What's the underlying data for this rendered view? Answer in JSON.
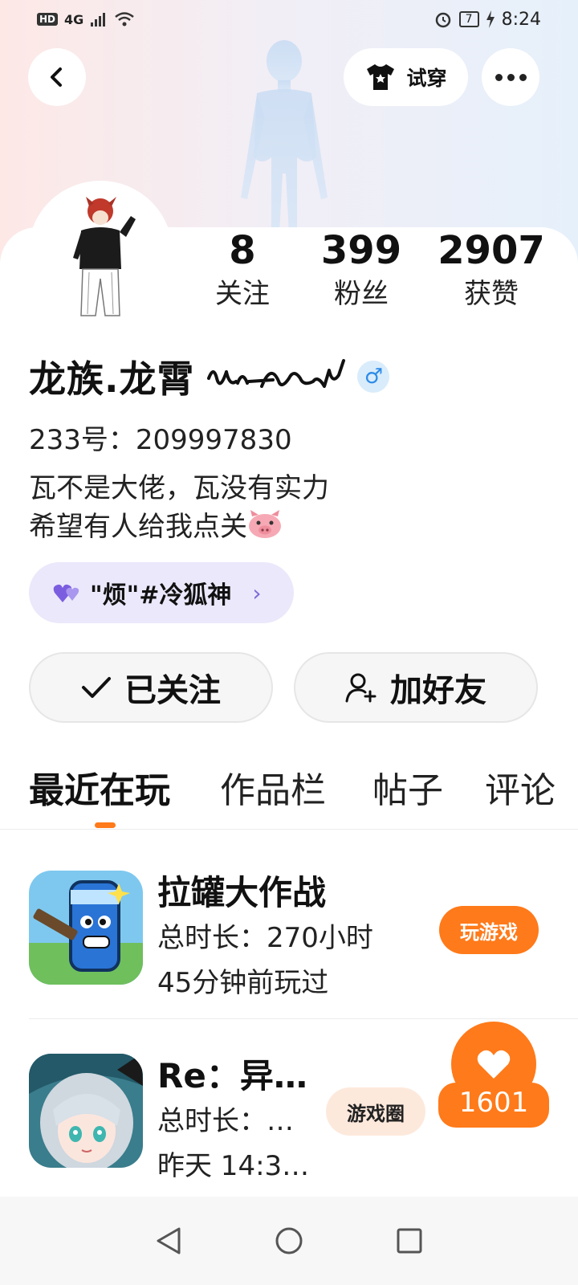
{
  "status_bar": {
    "network_badge": "HD",
    "signal": "4G",
    "battery": "7",
    "time": "8:24"
  },
  "header": {
    "tryon_label": "试穿"
  },
  "profile": {
    "name": "龙族.龙霄",
    "uid_label": "233号：209997830",
    "bio_lines": [
      "瓦不是大佬，瓦没有实力",
      "希望有人给我点关"
    ],
    "tag_label": "\"烦\"#冷狐神",
    "stats": [
      {
        "value": "8",
        "label": "关注"
      },
      {
        "value": "399",
        "label": "粉丝"
      },
      {
        "value": "2907",
        "label": "获赞"
      }
    ]
  },
  "actions": {
    "follow_label": "已关注",
    "add_friend_label": "加好友"
  },
  "tabs": [
    "最近在玩",
    "作品栏",
    "帖子",
    "评论"
  ],
  "games": [
    {
      "title": "拉罐大作战",
      "line1": "总时长：270小时",
      "line2": "45分钟前玩过",
      "button": "玩游戏"
    },
    {
      "title": "Re：异…",
      "line1": "总时长：…",
      "line2": "昨天 14:3…",
      "button": "游戏圈"
    }
  ],
  "like_float": {
    "count": "1601"
  },
  "colors": {
    "accent": "#ff7a1a",
    "tag_bg": "#ebe8fb",
    "gender": "#2d8be8"
  }
}
